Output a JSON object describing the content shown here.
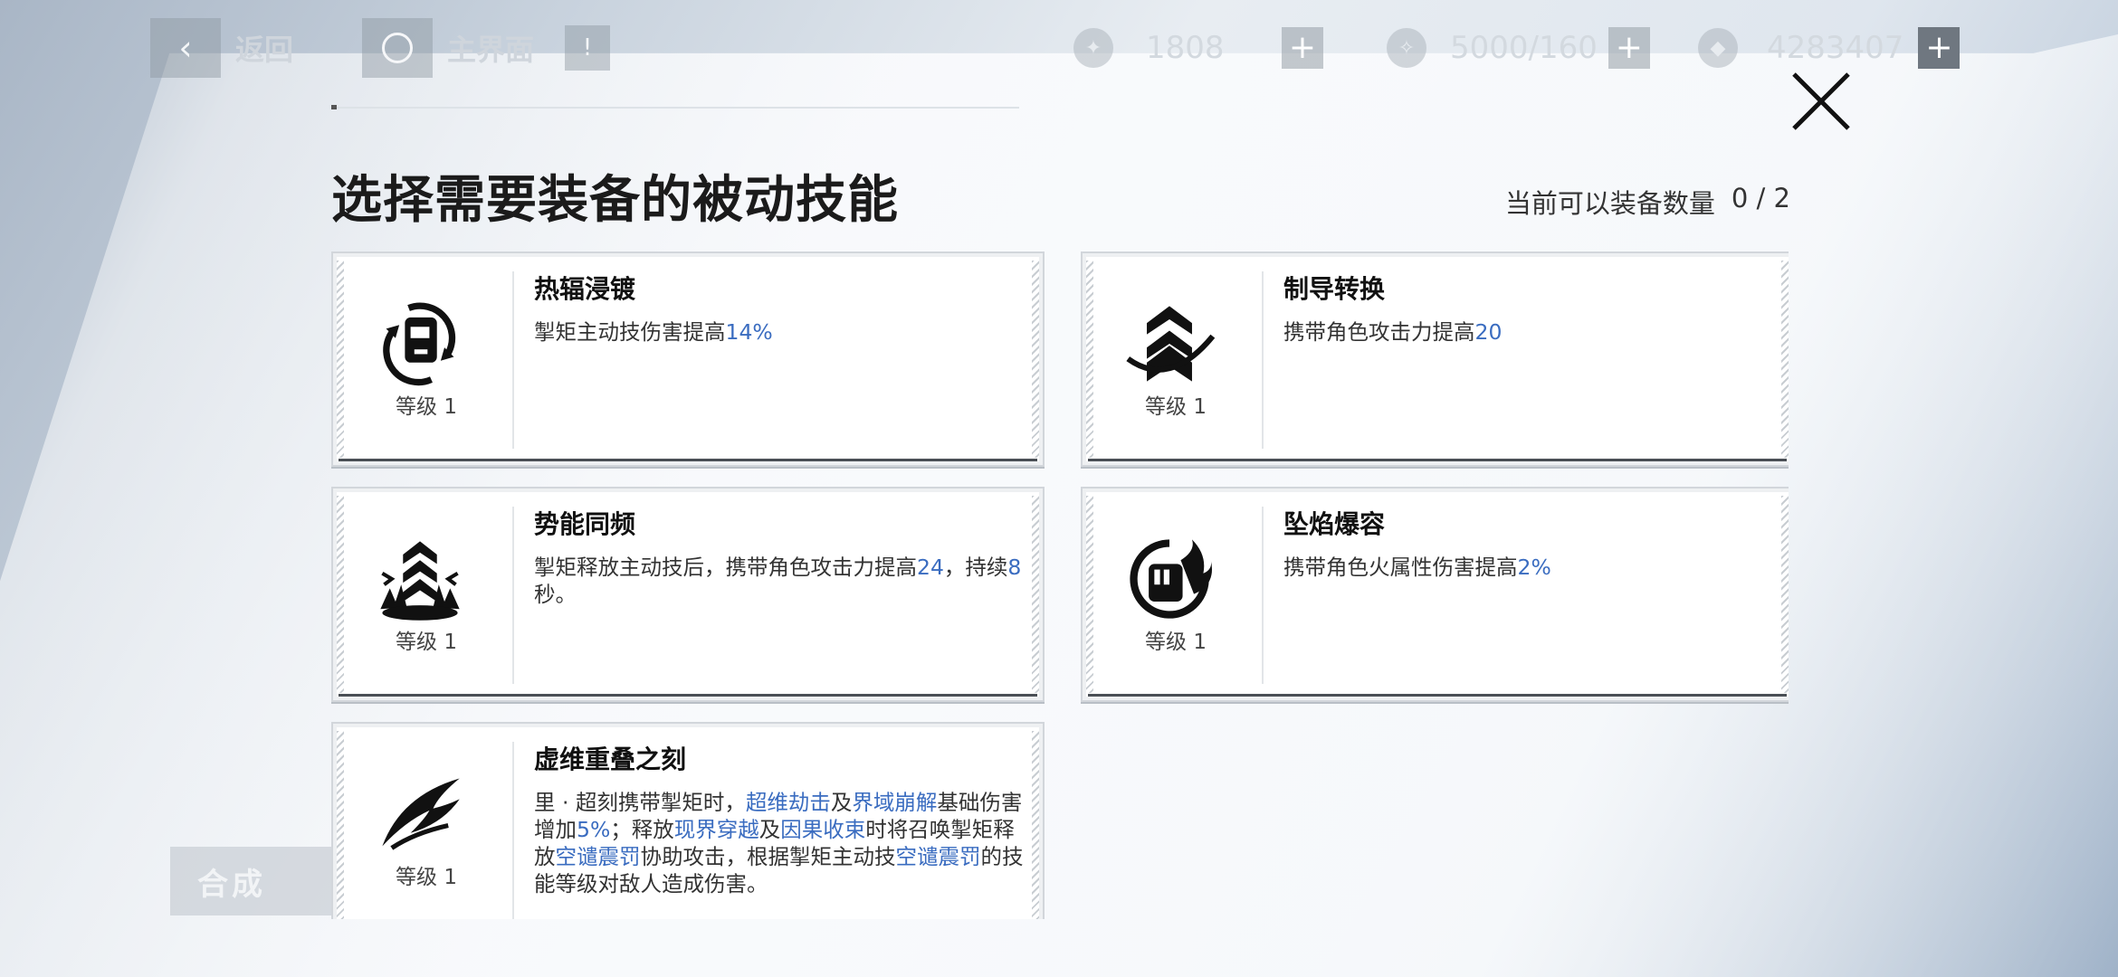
{
  "hud": {
    "back_label": "返回",
    "home_label": "主界面",
    "resources": [
      {
        "icon": "stamina-icon",
        "value": "1808"
      },
      {
        "icon": "energy-icon",
        "value": "5000/160"
      },
      {
        "icon": "currency-icon",
        "value": "4283407"
      }
    ],
    "craft_label": "合成"
  },
  "modal": {
    "title": "选择需要装备的被动技能",
    "equip_count_label": "当前可以装备数量",
    "equip_count_value": "0 / 2"
  },
  "skills": [
    {
      "name": "热辐浸镀",
      "level": "等级 1",
      "icon": "mech-helmet-icon",
      "desc": [
        {
          "t": "掣矩主动技伤害提高"
        },
        {
          "t": "14%",
          "hl": true
        }
      ]
    },
    {
      "name": "制导转换",
      "level": "等级 1",
      "icon": "chevron-rank-icon",
      "desc": [
        {
          "t": "携带角色攻击力提高"
        },
        {
          "t": "20",
          "hl": true
        }
      ]
    },
    {
      "name": "势能同频",
      "level": "等级 1",
      "icon": "rank-burst-icon",
      "desc": [
        {
          "t": "掣矩释放主动技后，携带角色攻击力提高"
        },
        {
          "t": "24",
          "hl": true
        },
        {
          "t": "，持续"
        },
        {
          "t": "8",
          "hl": true
        },
        {
          "t": "秒。"
        }
      ]
    },
    {
      "name": "坠焰爆容",
      "level": "等级 1",
      "icon": "flame-fist-icon",
      "desc": [
        {
          "t": "携带角色火属性伤害提高"
        },
        {
          "t": "2%",
          "hl": true
        }
      ]
    },
    {
      "name": "虚维重叠之刻",
      "level": "等级 1",
      "icon": "slash-wing-icon",
      "desc": [
        {
          "t": "里 · 超刻携带掣矩时，"
        },
        {
          "t": "超维劫击",
          "hl": true
        },
        {
          "t": "及"
        },
        {
          "t": "界域崩解",
          "hl": true
        },
        {
          "t": "基础伤害增加"
        },
        {
          "t": "5%",
          "hl": true
        },
        {
          "t": "；释放"
        },
        {
          "t": "现界穿越",
          "hl": true
        },
        {
          "t": "及"
        },
        {
          "t": "因果收束",
          "hl": true
        },
        {
          "t": "时将召唤掣矩释放"
        },
        {
          "t": "空谴震罚",
          "hl": true
        },
        {
          "t": "协助攻击，根据掣矩主动技"
        },
        {
          "t": "空谴震罚",
          "hl": true
        },
        {
          "t": "的技能等级对敌人造成伤害。"
        }
      ]
    }
  ],
  "colors": {
    "highlight": "#3a6cc0",
    "card_border": "#d2d6db"
  }
}
